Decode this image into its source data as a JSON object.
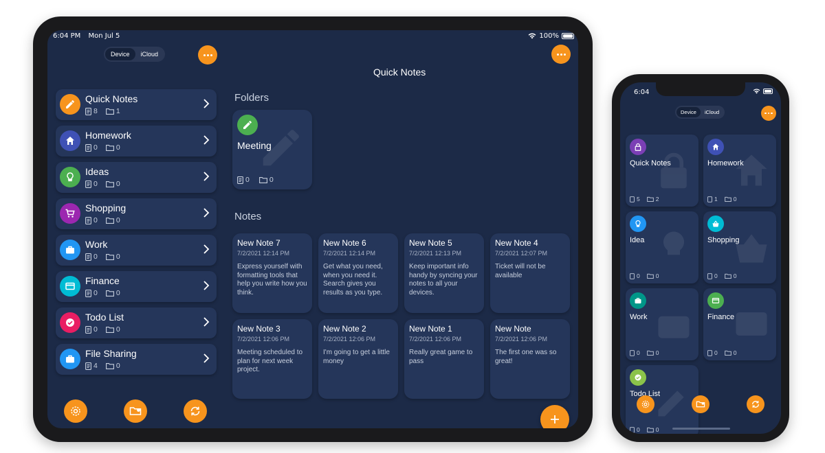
{
  "colors": {
    "accent": "#f7941d",
    "background": "#1c2a47",
    "card": "#25365a"
  },
  "ipad": {
    "status": {
      "time": "6:04 PM",
      "date": "Mon Jul 5",
      "battery": "100%"
    },
    "segment": {
      "device": "Device",
      "icloud": "iCloud"
    },
    "main_title": "Quick Notes",
    "sidebar": [
      {
        "title": "Quick Notes",
        "notes": "8",
        "folders": "1",
        "color": "#f7941d",
        "icon": "pencil-icon"
      },
      {
        "title": "Homework",
        "notes": "0",
        "folders": "0",
        "color": "#3f51b5",
        "icon": "home-icon"
      },
      {
        "title": "Ideas",
        "notes": "0",
        "folders": "0",
        "color": "#4caf50",
        "icon": "bulb-icon"
      },
      {
        "title": "Shopping",
        "notes": "0",
        "folders": "0",
        "color": "#9c27b0",
        "icon": "cart-icon"
      },
      {
        "title": "Work",
        "notes": "0",
        "folders": "0",
        "color": "#2196f3",
        "icon": "briefcase-icon"
      },
      {
        "title": "Finance",
        "notes": "0",
        "folders": "0",
        "color": "#00bcd4",
        "icon": "card-icon"
      },
      {
        "title": "Todo List",
        "notes": "0",
        "folders": "0",
        "color": "#e91e63",
        "icon": "check-icon"
      },
      {
        "title": "File Sharing",
        "notes": "4",
        "folders": "0",
        "color": "#2196f3",
        "icon": "briefcase-icon"
      }
    ],
    "folders_title": "Folders",
    "folder": {
      "name": "Meeting",
      "notes": "0",
      "folders": "0",
      "color": "#4caf50"
    },
    "notes_title": "Notes",
    "notes": [
      {
        "title": "New Note 7",
        "date": "7/2/2021 12:14 PM",
        "body": "Express yourself with formatting tools that help you write how you think."
      },
      {
        "title": "New Note 6",
        "date": "7/2/2021 12:14 PM",
        "body": "Get what you need, when you need it. Search gives you results as you type."
      },
      {
        "title": "New Note 5",
        "date": "7/2/2021 12:13 PM",
        "body": "Keep important info handy by syncing your notes to all your devices."
      },
      {
        "title": "New Note 4",
        "date": "7/2/2021 12:07 PM",
        "body": "Ticket will not be available"
      },
      {
        "title": "New Note 3",
        "date": "7/2/2021 12:06 PM",
        "body": "Meeting scheduled to plan for next week project."
      },
      {
        "title": "New Note 2",
        "date": "7/2/2021 12:06 PM",
        "body": "I'm going to get a little money"
      },
      {
        "title": "New Note 1",
        "date": "7/2/2021 12:06 PM",
        "body": "Really great game to pass"
      },
      {
        "title": "New Note",
        "date": "7/2/2021 12:06 PM",
        "body": "The first one was so great!"
      }
    ]
  },
  "iphone": {
    "status": {
      "time": "6:04"
    },
    "segment": {
      "device": "Device",
      "icloud": "iCloud"
    },
    "cards": [
      {
        "name": "Quick Notes",
        "notes": "5",
        "folders": "2",
        "color": "#7b3fb5"
      },
      {
        "name": "Homework",
        "notes": "1",
        "folders": "0",
        "color": "#3f51b5"
      },
      {
        "name": "Idea",
        "notes": "0",
        "folders": "0",
        "color": "#2196f3"
      },
      {
        "name": "Shopping",
        "notes": "0",
        "folders": "0",
        "color": "#00bcd4"
      },
      {
        "name": "Work",
        "notes": "0",
        "folders": "0",
        "color": "#009688"
      },
      {
        "name": "Finance",
        "notes": "0",
        "folders": "0",
        "color": "#4caf50"
      },
      {
        "name": "Todo List",
        "notes": "0",
        "folders": "0",
        "color": "#8bc34a"
      }
    ]
  }
}
